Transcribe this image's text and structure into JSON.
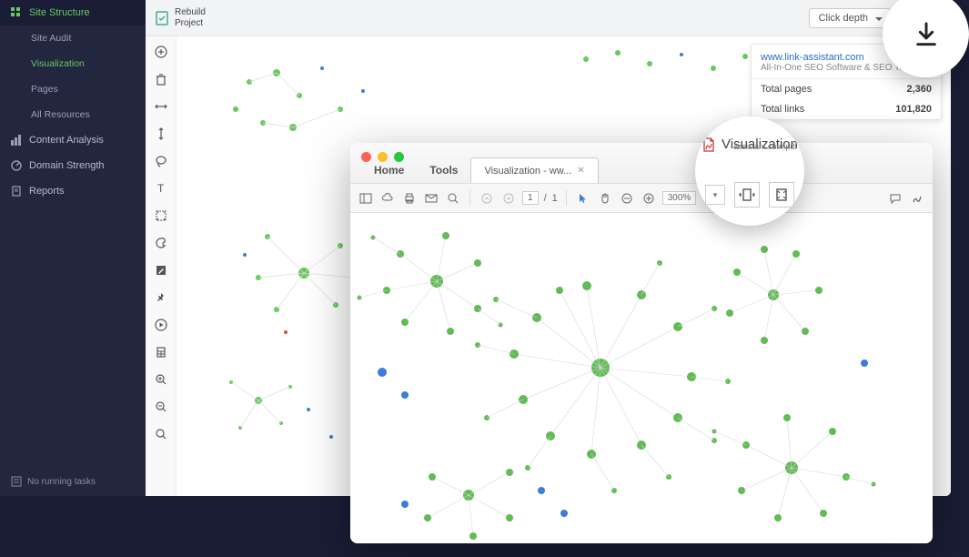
{
  "sidebar": {
    "items": [
      {
        "label": "Site Structure",
        "sub": false,
        "active": true
      },
      {
        "label": "Site Audit",
        "sub": true,
        "active": false
      },
      {
        "label": "Visualization",
        "sub": true,
        "active": true
      },
      {
        "label": "Pages",
        "sub": true,
        "active": false
      },
      {
        "label": "All Resources",
        "sub": true,
        "active": false
      },
      {
        "label": "Content Analysis",
        "sub": false,
        "active": false
      },
      {
        "label": "Domain Strength",
        "sub": false,
        "active": false
      },
      {
        "label": "Reports",
        "sub": false,
        "active": false
      }
    ],
    "bottom": "No running tasks"
  },
  "topbar": {
    "rebuild_line1": "Rebuild",
    "rebuild_line2": "Project",
    "click_depth": "Click depth"
  },
  "statbox": {
    "url": "www.link-assistant.com",
    "desc": "All-In-One SEO Software & SEO Tools | SEO P...",
    "rows": [
      {
        "label": "Total pages",
        "value": "2,360"
      },
      {
        "label": "Total links",
        "value": "101,820"
      }
    ]
  },
  "pdf": {
    "tab_home": "Home",
    "tab_tools": "Tools",
    "tab_doc": "Visualization - ww...",
    "page_cur": "1",
    "page_sep": "/",
    "page_total": "1",
    "zoom": "300%",
    "bubble_title": "Visualization",
    "bubble_small": "assistant.com.pdf"
  }
}
